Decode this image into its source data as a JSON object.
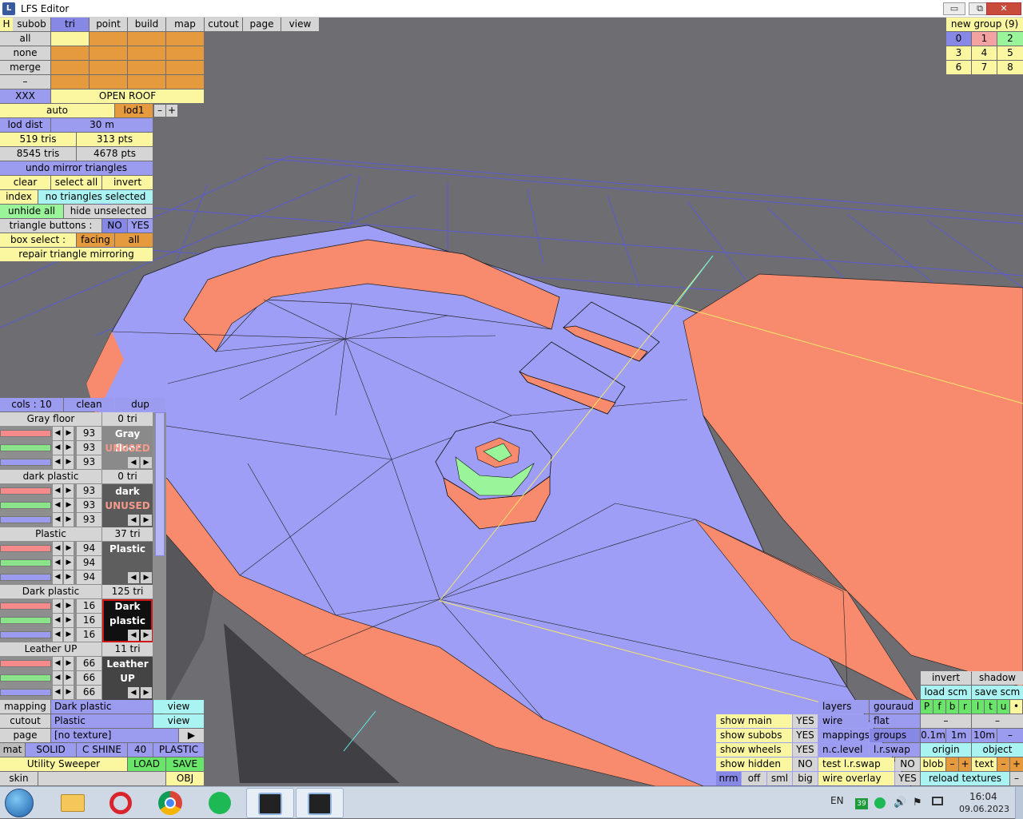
{
  "window": {
    "title": "LFS Editor",
    "minimize": "▭",
    "restore": "⧉",
    "close": "✕"
  },
  "menu": {
    "h": "H",
    "items": [
      "subob",
      "tri",
      "point",
      "build",
      "map",
      "cutout",
      "page",
      "view"
    ]
  },
  "groups_left": {
    "rows": [
      "all",
      "none",
      "merge",
      "–"
    ],
    "xxx": "XXX",
    "open_roof": "OPEN ROOF"
  },
  "lod": {
    "auto": "auto",
    "lod1": "lod1",
    "minus": "–",
    "plus": "+",
    "dist_label": "lod dist",
    "dist_value": "30 m"
  },
  "stats": {
    "tris": "519 tris",
    "pts": "313 pts",
    "total_tris": "8545 tris",
    "total_pts": "4678 pts"
  },
  "tri_panel": {
    "undo_mirror": "undo mirror triangles",
    "clear": "clear",
    "select_all": "select all",
    "invert": "invert",
    "index": "index",
    "no_sel": "no triangles selected",
    "unhide_all": "unhide all",
    "hide_unselected": "hide unselected",
    "tri_buttons": "triangle buttons :",
    "no": "NO",
    "yes": "YES",
    "box_select": "box select :",
    "facing": "facing",
    "all": "all",
    "repair": "repair triangle mirroring"
  },
  "group_panel": {
    "title": "new group (9)",
    "numbers": [
      "0",
      "1",
      "2",
      "3",
      "4",
      "5",
      "6",
      "7",
      "8"
    ]
  },
  "cols_bar": {
    "cols": "cols : 10",
    "clean": "clean",
    "dup": "dup"
  },
  "materials": [
    {
      "name": "Gray floor",
      "tri": "0 tri",
      "vals": [
        "93",
        "93",
        "93"
      ],
      "label": "Gray floor",
      "status": "UNUSED",
      "swatch": "#8a8a8a"
    },
    {
      "name": "dark plastic",
      "tri": "0 tri",
      "vals": [
        "93",
        "93",
        "93"
      ],
      "label": "dark",
      "status": "UNUSED",
      "swatch": "#5a5a5a"
    },
    {
      "name": "Plastic",
      "tri": "37 tri",
      "vals": [
        "94",
        "94",
        "94"
      ],
      "label": "Plastic",
      "status": "",
      "swatch": "#5e5e5e"
    },
    {
      "name": "Dark plastic",
      "tri": "125 tri",
      "vals": [
        "16",
        "16",
        "16"
      ],
      "label": "Dark",
      "label2": "plastic",
      "status": "",
      "swatch": "#101010"
    },
    {
      "name": "Leather UP",
      "tri": "11 tri",
      "vals": [
        "66",
        "66",
        "66"
      ],
      "label": "Leather",
      "label2": "UP",
      "status": "",
      "swatch": "#444444"
    }
  ],
  "bottom_left": {
    "mapping": "mapping",
    "mapping_val": "Dark plastic",
    "view": "view",
    "cutout": "cutout",
    "cutout_val": "Plastic",
    "page": "page",
    "page_val": "[no texture]",
    "page_arrow": "▶",
    "mat": "mat",
    "solid": "SOLID",
    "cshine": "C SHINE",
    "forty": "40",
    "plastic": "PLASTIC",
    "utility": "Utility Sweeper",
    "load": "LOAD",
    "save": "SAVE",
    "skin": "skin",
    "obj": "OBJ"
  },
  "bottom_right": {
    "invert": "invert",
    "shadow": "shadow",
    "load_scm": "load scm",
    "save_scm": "save scm",
    "letters": [
      "P",
      "f",
      "b",
      "r",
      "l",
      "t",
      "u",
      "•"
    ],
    "show_main": "show main",
    "show_subobs": "show subobs",
    "show_wheels": "show wheels",
    "show_hidden": "show hidden",
    "yes": "YES",
    "no": "NO",
    "nrm": "nrm",
    "off": "off",
    "sml": "sml",
    "big": "big",
    "layers": "layers",
    "gouraud": "gouraud",
    "wire": "wire",
    "flat": "flat",
    "mappings": "mappings",
    "groups": "groups",
    "nclevel": "n.c.level",
    "lrswap": "l.r.swap",
    "test_swap": "test l.r.swap",
    "wire_overlay": "wire overlay",
    "dash": "–",
    "d01": "0.1m",
    "d1": "1m",
    "d10": "10m",
    "origin": "origin",
    "object": "object",
    "blob": "blob",
    "text": "text",
    "minus": "–",
    "plus": "+",
    "reload": "reload textures"
  },
  "taskbar": {
    "lang": "EN",
    "badge": "39",
    "time": "16:04",
    "date": "09.06.2023"
  },
  "colors": {
    "blue_face": "#9e9ef7",
    "salmon_face": "#f88a6e",
    "bg": "#6e6e72",
    "grid": "#5b5bd6"
  }
}
